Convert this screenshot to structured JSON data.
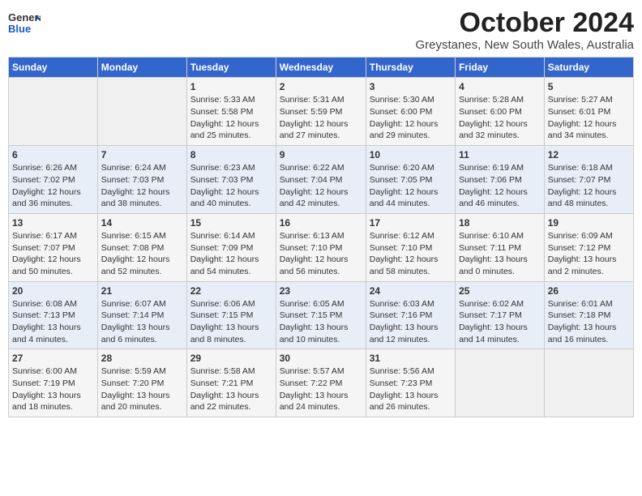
{
  "header": {
    "logo_general": "General",
    "logo_blue": "Blue",
    "month": "October 2024",
    "location": "Greystanes, New South Wales, Australia"
  },
  "days_of_week": [
    "Sunday",
    "Monday",
    "Tuesday",
    "Wednesday",
    "Thursday",
    "Friday",
    "Saturday"
  ],
  "weeks": [
    [
      {
        "day": "",
        "info": ""
      },
      {
        "day": "",
        "info": ""
      },
      {
        "day": "1",
        "info": "Sunrise: 5:33 AM\nSunset: 5:58 PM\nDaylight: 12 hours\nand 25 minutes."
      },
      {
        "day": "2",
        "info": "Sunrise: 5:31 AM\nSunset: 5:59 PM\nDaylight: 12 hours\nand 27 minutes."
      },
      {
        "day": "3",
        "info": "Sunrise: 5:30 AM\nSunset: 6:00 PM\nDaylight: 12 hours\nand 29 minutes."
      },
      {
        "day": "4",
        "info": "Sunrise: 5:28 AM\nSunset: 6:00 PM\nDaylight: 12 hours\nand 32 minutes."
      },
      {
        "day": "5",
        "info": "Sunrise: 5:27 AM\nSunset: 6:01 PM\nDaylight: 12 hours\nand 34 minutes."
      }
    ],
    [
      {
        "day": "6",
        "info": "Sunrise: 6:26 AM\nSunset: 7:02 PM\nDaylight: 12 hours\nand 36 minutes."
      },
      {
        "day": "7",
        "info": "Sunrise: 6:24 AM\nSunset: 7:03 PM\nDaylight: 12 hours\nand 38 minutes."
      },
      {
        "day": "8",
        "info": "Sunrise: 6:23 AM\nSunset: 7:03 PM\nDaylight: 12 hours\nand 40 minutes."
      },
      {
        "day": "9",
        "info": "Sunrise: 6:22 AM\nSunset: 7:04 PM\nDaylight: 12 hours\nand 42 minutes."
      },
      {
        "day": "10",
        "info": "Sunrise: 6:20 AM\nSunset: 7:05 PM\nDaylight: 12 hours\nand 44 minutes."
      },
      {
        "day": "11",
        "info": "Sunrise: 6:19 AM\nSunset: 7:06 PM\nDaylight: 12 hours\nand 46 minutes."
      },
      {
        "day": "12",
        "info": "Sunrise: 6:18 AM\nSunset: 7:07 PM\nDaylight: 12 hours\nand 48 minutes."
      }
    ],
    [
      {
        "day": "13",
        "info": "Sunrise: 6:17 AM\nSunset: 7:07 PM\nDaylight: 12 hours\nand 50 minutes."
      },
      {
        "day": "14",
        "info": "Sunrise: 6:15 AM\nSunset: 7:08 PM\nDaylight: 12 hours\nand 52 minutes."
      },
      {
        "day": "15",
        "info": "Sunrise: 6:14 AM\nSunset: 7:09 PM\nDaylight: 12 hours\nand 54 minutes."
      },
      {
        "day": "16",
        "info": "Sunrise: 6:13 AM\nSunset: 7:10 PM\nDaylight: 12 hours\nand 56 minutes."
      },
      {
        "day": "17",
        "info": "Sunrise: 6:12 AM\nSunset: 7:10 PM\nDaylight: 12 hours\nand 58 minutes."
      },
      {
        "day": "18",
        "info": "Sunrise: 6:10 AM\nSunset: 7:11 PM\nDaylight: 13 hours\nand 0 minutes."
      },
      {
        "day": "19",
        "info": "Sunrise: 6:09 AM\nSunset: 7:12 PM\nDaylight: 13 hours\nand 2 minutes."
      }
    ],
    [
      {
        "day": "20",
        "info": "Sunrise: 6:08 AM\nSunset: 7:13 PM\nDaylight: 13 hours\nand 4 minutes."
      },
      {
        "day": "21",
        "info": "Sunrise: 6:07 AM\nSunset: 7:14 PM\nDaylight: 13 hours\nand 6 minutes."
      },
      {
        "day": "22",
        "info": "Sunrise: 6:06 AM\nSunset: 7:15 PM\nDaylight: 13 hours\nand 8 minutes."
      },
      {
        "day": "23",
        "info": "Sunrise: 6:05 AM\nSunset: 7:15 PM\nDaylight: 13 hours\nand 10 minutes."
      },
      {
        "day": "24",
        "info": "Sunrise: 6:03 AM\nSunset: 7:16 PM\nDaylight: 13 hours\nand 12 minutes."
      },
      {
        "day": "25",
        "info": "Sunrise: 6:02 AM\nSunset: 7:17 PM\nDaylight: 13 hours\nand 14 minutes."
      },
      {
        "day": "26",
        "info": "Sunrise: 6:01 AM\nSunset: 7:18 PM\nDaylight: 13 hours\nand 16 minutes."
      }
    ],
    [
      {
        "day": "27",
        "info": "Sunrise: 6:00 AM\nSunset: 7:19 PM\nDaylight: 13 hours\nand 18 minutes."
      },
      {
        "day": "28",
        "info": "Sunrise: 5:59 AM\nSunset: 7:20 PM\nDaylight: 13 hours\nand 20 minutes."
      },
      {
        "day": "29",
        "info": "Sunrise: 5:58 AM\nSunset: 7:21 PM\nDaylight: 13 hours\nand 22 minutes."
      },
      {
        "day": "30",
        "info": "Sunrise: 5:57 AM\nSunset: 7:22 PM\nDaylight: 13 hours\nand 24 minutes."
      },
      {
        "day": "31",
        "info": "Sunrise: 5:56 AM\nSunset: 7:23 PM\nDaylight: 13 hours\nand 26 minutes."
      },
      {
        "day": "",
        "info": ""
      },
      {
        "day": "",
        "info": ""
      }
    ]
  ]
}
